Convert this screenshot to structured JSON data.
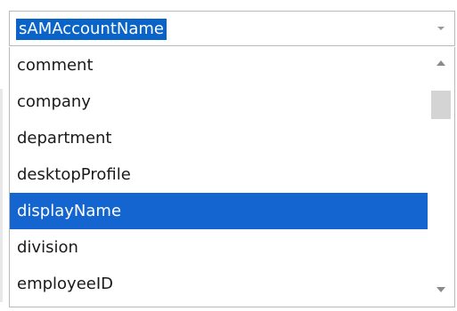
{
  "combo": {
    "selected_value": "sAMAccountName",
    "dropdown_icon": "chevron-down-icon"
  },
  "list": {
    "items": [
      {
        "label": "comment"
      },
      {
        "label": "company"
      },
      {
        "label": "department"
      },
      {
        "label": "desktopProfile"
      },
      {
        "label": "displayName",
        "selected": true
      },
      {
        "label": "division"
      },
      {
        "label": "employeeID"
      }
    ]
  },
  "scrollbar": {
    "up_icon": "scroll-up-arrow-icon",
    "down_icon": "scroll-down-arrow-icon"
  },
  "colors": {
    "selection": "#1565d0",
    "text": "#1a1a1a",
    "border": "#b9b9b9"
  }
}
